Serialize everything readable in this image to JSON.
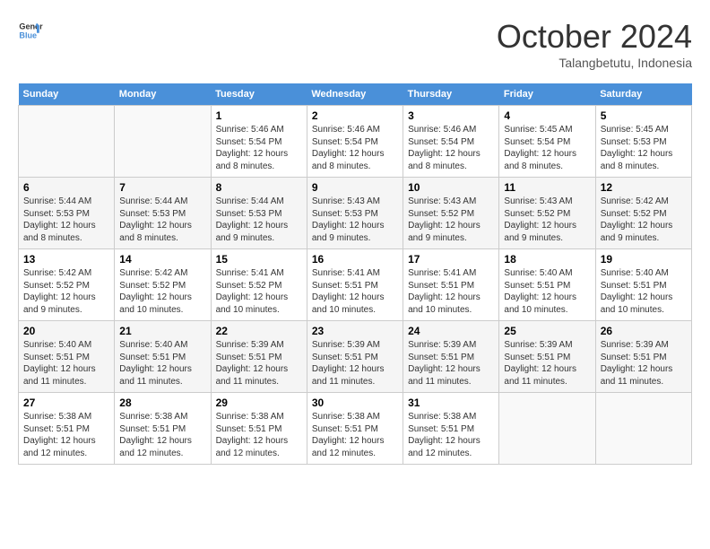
{
  "header": {
    "logo_line1": "General",
    "logo_line2": "Blue",
    "month": "October 2024",
    "location": "Talangbetutu, Indonesia"
  },
  "days_of_week": [
    "Sunday",
    "Monday",
    "Tuesday",
    "Wednesday",
    "Thursday",
    "Friday",
    "Saturday"
  ],
  "weeks": [
    [
      {
        "day": "",
        "info": ""
      },
      {
        "day": "",
        "info": ""
      },
      {
        "day": "1",
        "info": "Sunrise: 5:46 AM\nSunset: 5:54 PM\nDaylight: 12 hours and 8 minutes."
      },
      {
        "day": "2",
        "info": "Sunrise: 5:46 AM\nSunset: 5:54 PM\nDaylight: 12 hours and 8 minutes."
      },
      {
        "day": "3",
        "info": "Sunrise: 5:46 AM\nSunset: 5:54 PM\nDaylight: 12 hours and 8 minutes."
      },
      {
        "day": "4",
        "info": "Sunrise: 5:45 AM\nSunset: 5:54 PM\nDaylight: 12 hours and 8 minutes."
      },
      {
        "day": "5",
        "info": "Sunrise: 5:45 AM\nSunset: 5:53 PM\nDaylight: 12 hours and 8 minutes."
      }
    ],
    [
      {
        "day": "6",
        "info": "Sunrise: 5:44 AM\nSunset: 5:53 PM\nDaylight: 12 hours and 8 minutes."
      },
      {
        "day": "7",
        "info": "Sunrise: 5:44 AM\nSunset: 5:53 PM\nDaylight: 12 hours and 8 minutes."
      },
      {
        "day": "8",
        "info": "Sunrise: 5:44 AM\nSunset: 5:53 PM\nDaylight: 12 hours and 9 minutes."
      },
      {
        "day": "9",
        "info": "Sunrise: 5:43 AM\nSunset: 5:53 PM\nDaylight: 12 hours and 9 minutes."
      },
      {
        "day": "10",
        "info": "Sunrise: 5:43 AM\nSunset: 5:52 PM\nDaylight: 12 hours and 9 minutes."
      },
      {
        "day": "11",
        "info": "Sunrise: 5:43 AM\nSunset: 5:52 PM\nDaylight: 12 hours and 9 minutes."
      },
      {
        "day": "12",
        "info": "Sunrise: 5:42 AM\nSunset: 5:52 PM\nDaylight: 12 hours and 9 minutes."
      }
    ],
    [
      {
        "day": "13",
        "info": "Sunrise: 5:42 AM\nSunset: 5:52 PM\nDaylight: 12 hours and 9 minutes."
      },
      {
        "day": "14",
        "info": "Sunrise: 5:42 AM\nSunset: 5:52 PM\nDaylight: 12 hours and 10 minutes."
      },
      {
        "day": "15",
        "info": "Sunrise: 5:41 AM\nSunset: 5:52 PM\nDaylight: 12 hours and 10 minutes."
      },
      {
        "day": "16",
        "info": "Sunrise: 5:41 AM\nSunset: 5:51 PM\nDaylight: 12 hours and 10 minutes."
      },
      {
        "day": "17",
        "info": "Sunrise: 5:41 AM\nSunset: 5:51 PM\nDaylight: 12 hours and 10 minutes."
      },
      {
        "day": "18",
        "info": "Sunrise: 5:40 AM\nSunset: 5:51 PM\nDaylight: 12 hours and 10 minutes."
      },
      {
        "day": "19",
        "info": "Sunrise: 5:40 AM\nSunset: 5:51 PM\nDaylight: 12 hours and 10 minutes."
      }
    ],
    [
      {
        "day": "20",
        "info": "Sunrise: 5:40 AM\nSunset: 5:51 PM\nDaylight: 12 hours and 11 minutes."
      },
      {
        "day": "21",
        "info": "Sunrise: 5:40 AM\nSunset: 5:51 PM\nDaylight: 12 hours and 11 minutes."
      },
      {
        "day": "22",
        "info": "Sunrise: 5:39 AM\nSunset: 5:51 PM\nDaylight: 12 hours and 11 minutes."
      },
      {
        "day": "23",
        "info": "Sunrise: 5:39 AM\nSunset: 5:51 PM\nDaylight: 12 hours and 11 minutes."
      },
      {
        "day": "24",
        "info": "Sunrise: 5:39 AM\nSunset: 5:51 PM\nDaylight: 12 hours and 11 minutes."
      },
      {
        "day": "25",
        "info": "Sunrise: 5:39 AM\nSunset: 5:51 PM\nDaylight: 12 hours and 11 minutes."
      },
      {
        "day": "26",
        "info": "Sunrise: 5:39 AM\nSunset: 5:51 PM\nDaylight: 12 hours and 11 minutes."
      }
    ],
    [
      {
        "day": "27",
        "info": "Sunrise: 5:38 AM\nSunset: 5:51 PM\nDaylight: 12 hours and 12 minutes."
      },
      {
        "day": "28",
        "info": "Sunrise: 5:38 AM\nSunset: 5:51 PM\nDaylight: 12 hours and 12 minutes."
      },
      {
        "day": "29",
        "info": "Sunrise: 5:38 AM\nSunset: 5:51 PM\nDaylight: 12 hours and 12 minutes."
      },
      {
        "day": "30",
        "info": "Sunrise: 5:38 AM\nSunset: 5:51 PM\nDaylight: 12 hours and 12 minutes."
      },
      {
        "day": "31",
        "info": "Sunrise: 5:38 AM\nSunset: 5:51 PM\nDaylight: 12 hours and 12 minutes."
      },
      {
        "day": "",
        "info": ""
      },
      {
        "day": "",
        "info": ""
      }
    ]
  ]
}
